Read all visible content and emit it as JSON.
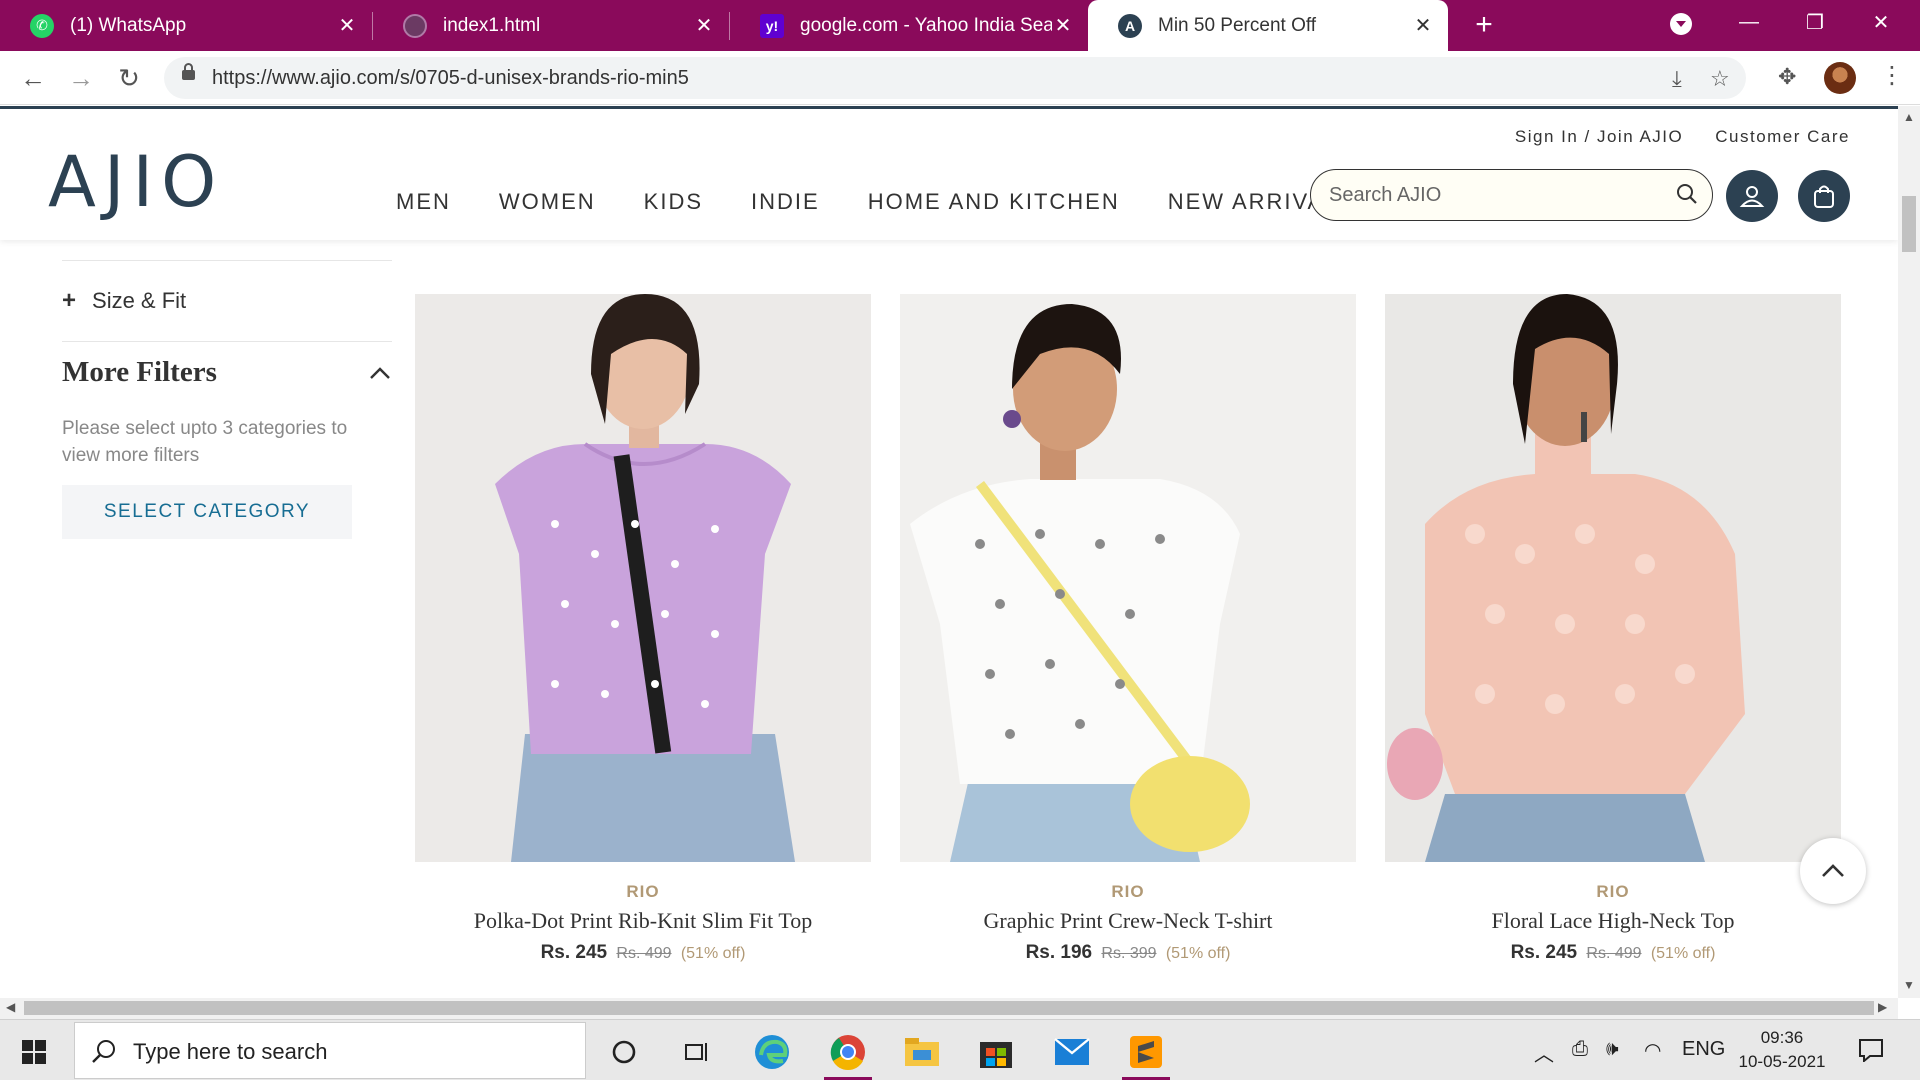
{
  "browser": {
    "tabs": [
      {
        "title": "(1) WhatsApp",
        "icon": "whatsapp-icon",
        "active": false
      },
      {
        "title": "index1.html",
        "icon": "globe-icon",
        "active": false
      },
      {
        "title": "google.com - Yahoo India Search",
        "icon": "yahoo-icon",
        "active": false
      },
      {
        "title": "Min 50 Percent Off",
        "icon": "ajio-icon",
        "active": true
      }
    ],
    "url": "https://www.ajio.com/s/0705-d-unisex-brands-rio-min5",
    "colors": {
      "tabbar": "#8a0a5b"
    }
  },
  "site": {
    "logo": "AJIO",
    "top_links": {
      "sign_in": "Sign In / Join AJIO",
      "customer_care": "Customer Care"
    },
    "nav": [
      "MEN",
      "WOMEN",
      "KIDS",
      "INDIE",
      "HOME AND KITCHEN",
      "NEW ARRIVALS"
    ],
    "search_placeholder": "Search AJIO",
    "colors": {
      "brand": "#2c4152",
      "gold": "#b19975",
      "link": "#176d93"
    }
  },
  "filters": {
    "size_fit": "Size & Fit",
    "more_filters": "More Filters",
    "help": "Please select upto 3 categories to view more filters",
    "select_category": "SELECT CATEGORY"
  },
  "products": [
    {
      "brand": "RIO",
      "name": "Polka-Dot Print Rib-Knit Slim Fit Top",
      "price": "Rs. 245",
      "mrp": "Rs. 499",
      "off": "(51% off)"
    },
    {
      "brand": "RIO",
      "name": "Graphic Print Crew-Neck T-shirt",
      "price": "Rs. 196",
      "mrp": "Rs. 399",
      "off": "(51% off)"
    },
    {
      "brand": "RIO",
      "name": "Floral Lace High-Neck Top",
      "price": "Rs. 245",
      "mrp": "Rs. 499",
      "off": "(51% off)"
    }
  ],
  "taskbar": {
    "search_text": "Type here to search",
    "language": "ENG",
    "time": "09:36",
    "date": "10-05-2021"
  }
}
